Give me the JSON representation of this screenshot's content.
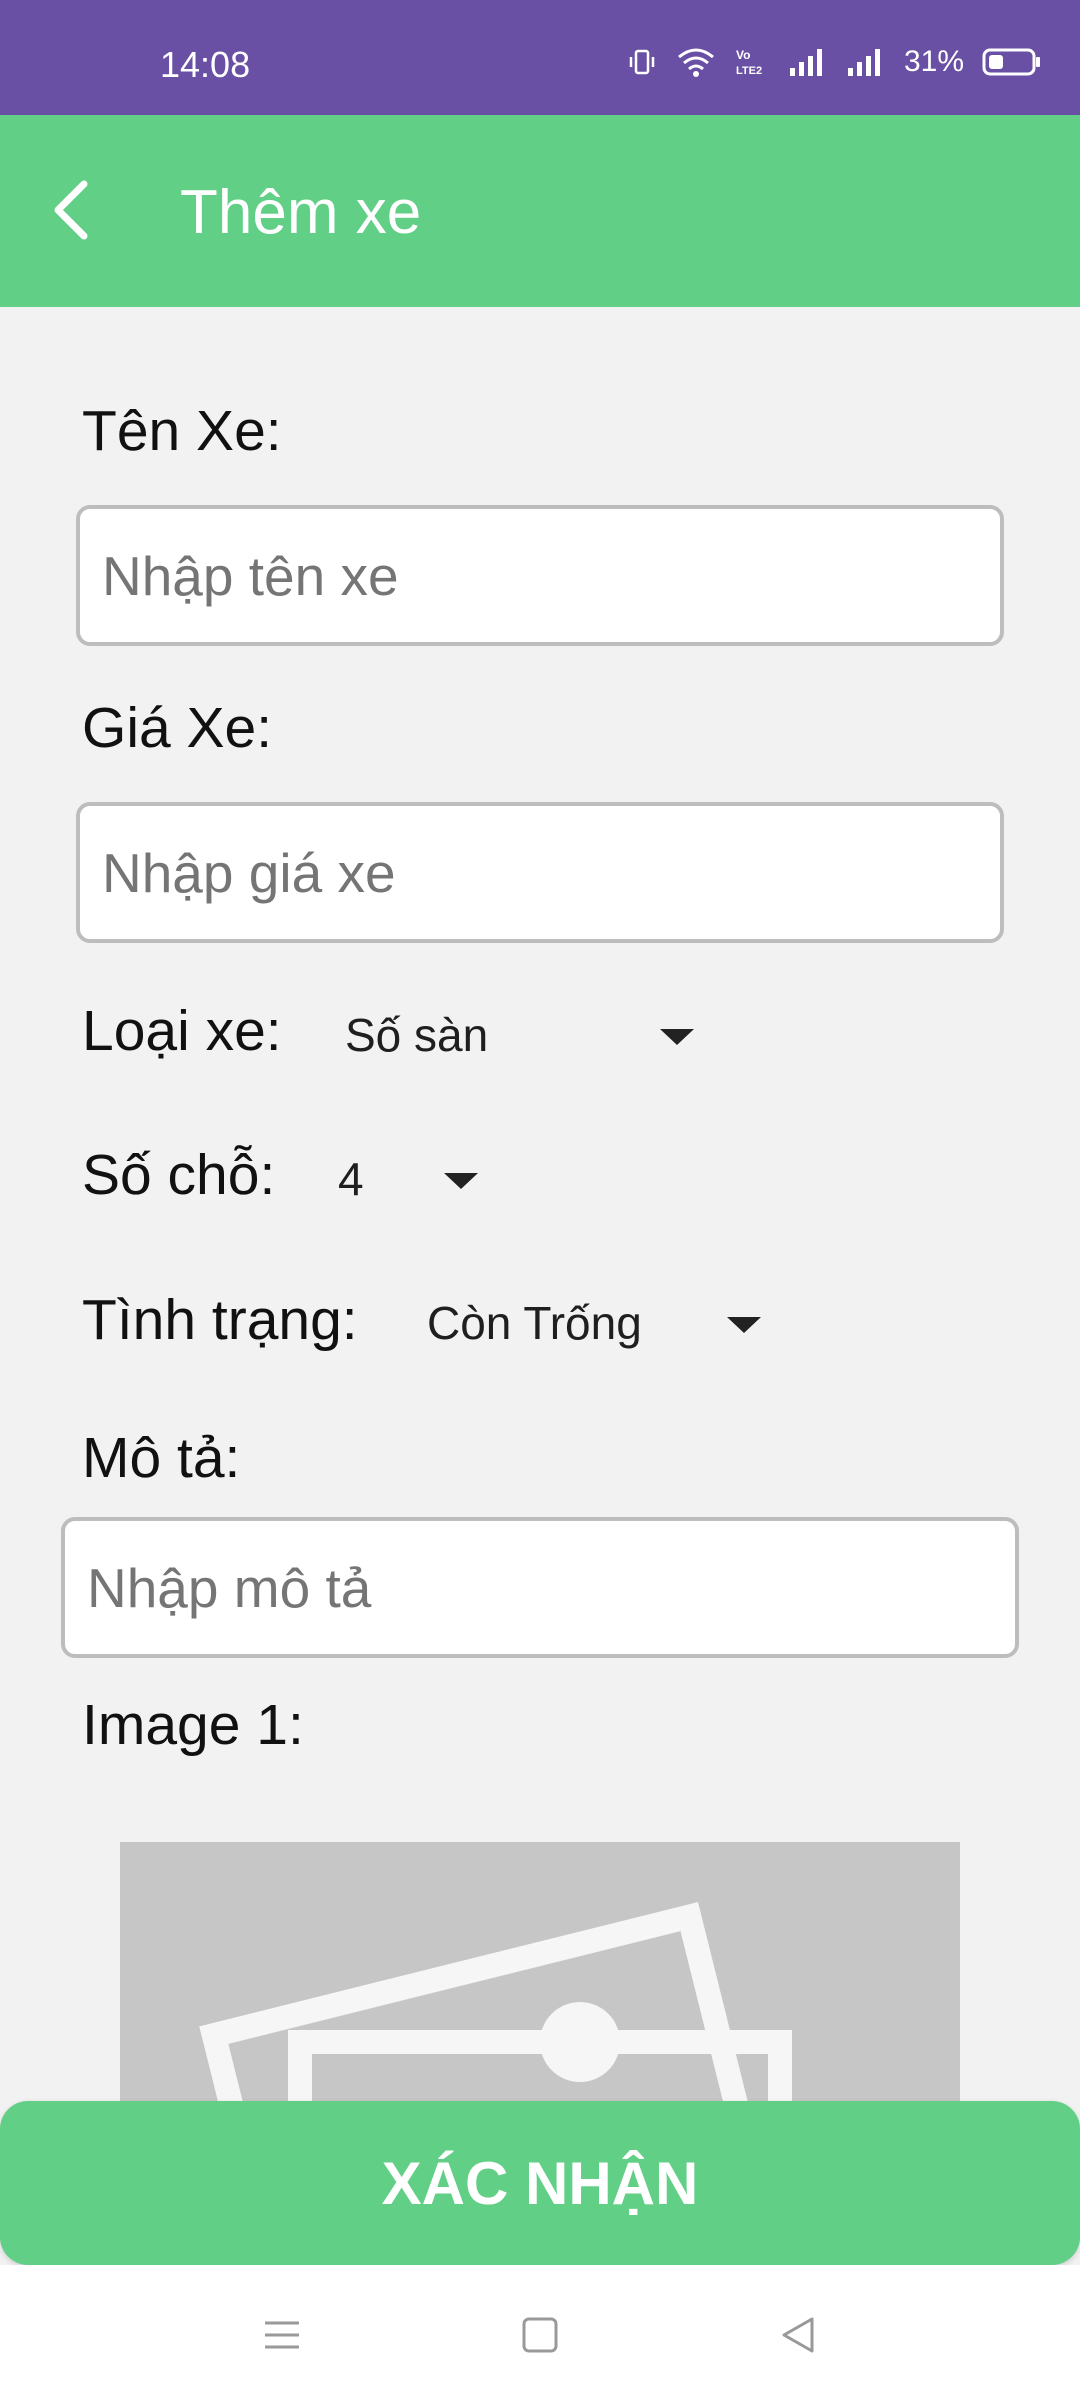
{
  "status_bar": {
    "time": "14:08",
    "battery": "31%",
    "icons": [
      "vibrate-icon",
      "wifi-icon",
      "volte-icon",
      "signal-icon",
      "signal-icon",
      "battery-icon"
    ]
  },
  "app_bar": {
    "title": "Thêm xe",
    "back_icon": "chevron-left-icon",
    "color": "#62cf87"
  },
  "form": {
    "name": {
      "label": "Tên Xe:",
      "placeholder": "Nhập tên xe",
      "value": ""
    },
    "price": {
      "label": "Giá Xe:",
      "placeholder": "Nhập giá xe",
      "value": ""
    },
    "type": {
      "label": "Loại xe:",
      "selected": "Số sàn"
    },
    "seats": {
      "label": "Số chỗ:",
      "selected": "4"
    },
    "status": {
      "label": "Tình trạng:",
      "selected": "Còn Trống"
    },
    "description": {
      "label": "Mô tả:",
      "placeholder": "Nhập mô tả",
      "value": ""
    },
    "image1": {
      "label": "Image 1:",
      "icon": "image-placeholder-icon"
    }
  },
  "confirm_button": {
    "label": "XÁC NHẬN"
  },
  "nav_bar": {
    "icons": [
      "menu-icon",
      "home-square-icon",
      "back-triangle-icon"
    ]
  },
  "colors": {
    "status_bar": "#6950a4",
    "accent": "#62cf87",
    "background": "#f2f2f2"
  }
}
